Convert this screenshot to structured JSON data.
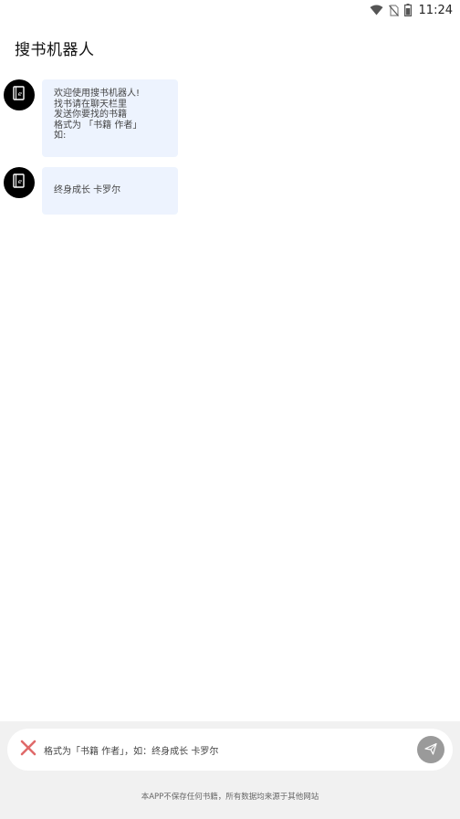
{
  "status_bar": {
    "time": "11:24",
    "icons": [
      "wifi-icon",
      "no-sim-icon",
      "battery-icon"
    ]
  },
  "app": {
    "title": "搜书机器人"
  },
  "messages": [
    {
      "avatar_icon": "book-icon",
      "lines": [
        "欢迎使用搜书机器人!",
        "找书请在聊天栏里",
        "发送你要找的书籍",
        "格式为 「书籍 作者」",
        "如:"
      ]
    },
    {
      "avatar_icon": "book-icon",
      "lines": [
        "终身成长 卡罗尔"
      ]
    }
  ],
  "input_bar": {
    "clear_icon": "close-icon",
    "text": "格式为「书籍 作者」，如：终身成长 卡罗尔",
    "send_icon": "send-icon"
  },
  "footer": {
    "disclaimer": "本APP不保存任何书籍，所有数据均来源于其他网站"
  },
  "colors": {
    "bubble": "#edf3fe",
    "avatar": "#000000",
    "bottom_panel": "#f1f1f1",
    "send_button": "#9a9a9a",
    "clear_icon": "#e06a6a"
  }
}
